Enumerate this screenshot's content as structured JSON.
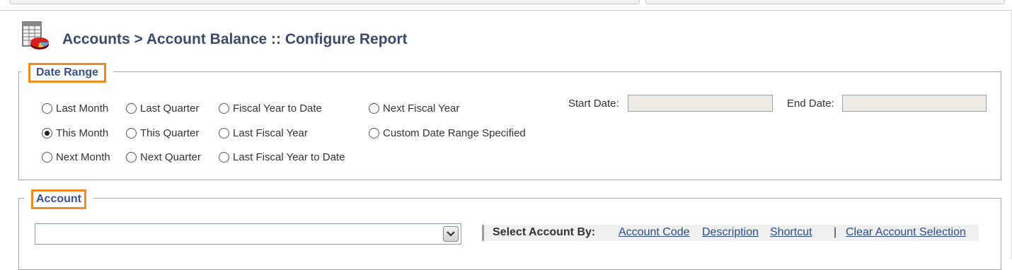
{
  "header": {
    "title": "Accounts > Account Balance :: Configure Report",
    "icon": "report-pie-chart-icon"
  },
  "date_range": {
    "legend": "Date Range",
    "options": [
      {
        "label": "Last Month",
        "checked": false
      },
      {
        "label": "Last Quarter",
        "checked": false
      },
      {
        "label": "Fiscal Year to Date",
        "checked": false
      },
      {
        "label": "Next Fiscal Year",
        "checked": false
      },
      {
        "label": "This Month",
        "checked": true
      },
      {
        "label": "This Quarter",
        "checked": false
      },
      {
        "label": "Last Fiscal Year",
        "checked": false
      },
      {
        "label": "Custom Date Range Specified",
        "checked": false
      },
      {
        "label": "Next Month",
        "checked": false
      },
      {
        "label": "Next Quarter",
        "checked": false
      },
      {
        "label": "Last Fiscal Year to Date",
        "checked": false
      }
    ],
    "start_date_label": "Start Date:",
    "start_date_value": "",
    "end_date_label": "End Date:",
    "end_date_value": ""
  },
  "account": {
    "legend": "Account",
    "selected_value": "",
    "select_by_label": "Select Account By:",
    "links": {
      "account_code": "Account Code",
      "description": "Description",
      "shortcut": "Shortcut",
      "separator": "|",
      "clear": "Clear Account Selection"
    }
  },
  "colors": {
    "legend_highlight": "#f08a24",
    "title": "#3c4a6b",
    "link": "#2a4d8f",
    "input_bg": "#ecebe4"
  }
}
